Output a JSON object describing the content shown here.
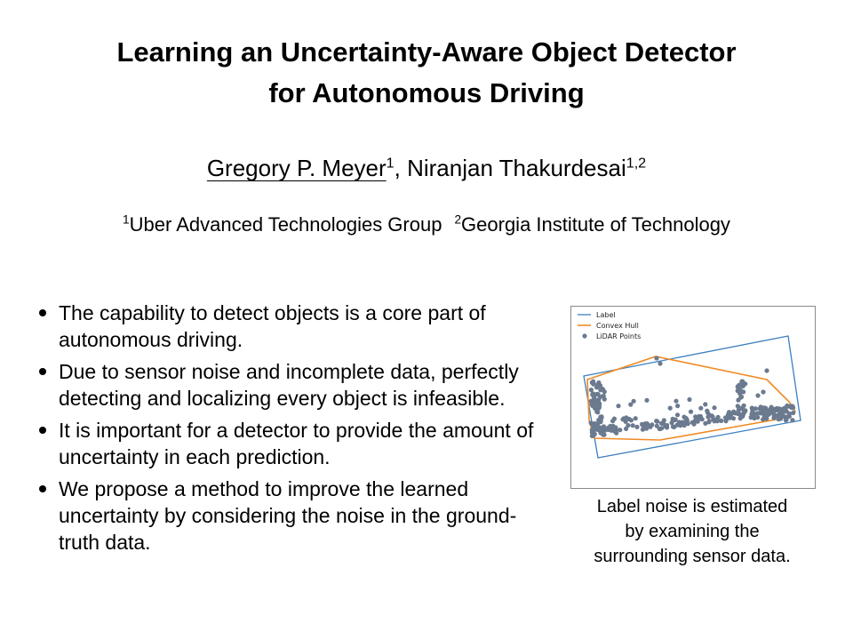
{
  "title": {
    "line1": "Learning an Uncertainty-Aware Object Detector",
    "line2": "for Autonomous Driving"
  },
  "authors": {
    "first_name": "Gregory P. Meyer",
    "first_sup": "1",
    "separator": ", ",
    "second_name": "Niranjan Thakurdesai",
    "second_sup": "1,2"
  },
  "affiliations": [
    {
      "sup": "1",
      "name": "Uber Advanced Technologies Group"
    },
    {
      "sup": "2",
      "name": "Georgia Institute of Technology"
    }
  ],
  "bullets": [
    "The capability to detect objects is a core part of autonomous driving.",
    "Due to sensor noise and incomplete data, perfectly detecting and localizing every object is infeasible.",
    "It is important for a detector to provide the amount of uncertainty in each prediction.",
    "We propose a method to improve the learned uncertainty by considering the noise in the ground-truth data."
  ],
  "figure": {
    "legend": [
      "Label",
      "Convex Hull",
      "LiDAR Points"
    ],
    "colors": {
      "label": "#3b7fbf",
      "convex_hull": "#f08a24",
      "lidar_points": "#6b7a8f"
    }
  },
  "caption": {
    "line1": "Label noise is estimated",
    "line2": "by examining the",
    "line3": "surrounding sensor data."
  }
}
